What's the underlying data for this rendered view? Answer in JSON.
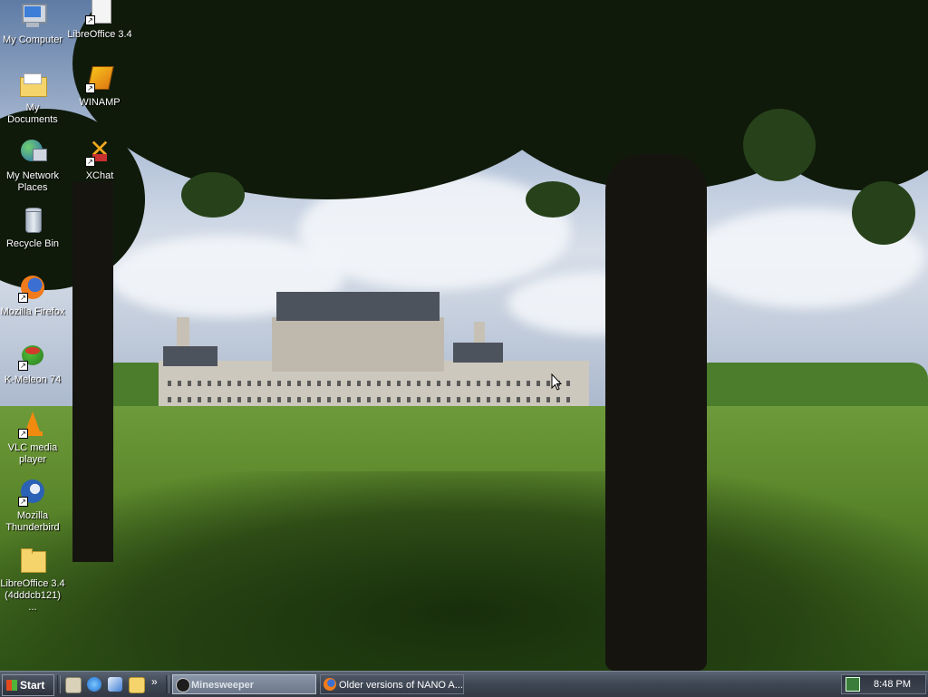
{
  "desktop": {
    "icons": [
      {
        "label": "My Computer",
        "icon": "computer-icon",
        "shortcut": false
      },
      {
        "label": "LibreOffice 3.4",
        "icon": "document-icon",
        "shortcut": true
      },
      {
        "label": "My Documents",
        "icon": "folder-icon",
        "shortcut": false
      },
      {
        "label": "WINAMP",
        "icon": "winamp-icon",
        "shortcut": true
      },
      {
        "label": "My Network Places",
        "icon": "network-icon",
        "shortcut": false
      },
      {
        "label": "XChat",
        "icon": "xchat-icon",
        "shortcut": true
      },
      {
        "label": "Recycle Bin",
        "icon": "recycle-bin-icon",
        "shortcut": false
      },
      {
        "label": "Mozilla Firefox",
        "icon": "firefox-icon",
        "shortcut": true
      },
      {
        "label": "K-Meleon 74",
        "icon": "kmeleon-icon",
        "shortcut": true
      },
      {
        "label": "VLC media player",
        "icon": "vlc-icon",
        "shortcut": true
      },
      {
        "label": "Mozilla Thunderbird",
        "icon": "thunderbird-icon",
        "shortcut": true
      },
      {
        "label": "LibreOffice 3.4 (4dddcb121) ...",
        "icon": "folder-icon",
        "shortcut": false
      }
    ]
  },
  "taskbar": {
    "start_label": "Start",
    "quick_launch": [
      "show-desktop-icon",
      "internet-explorer-icon",
      "outlook-express-icon",
      "windows-explorer-icon"
    ],
    "overflow_label": "»",
    "tasks": [
      {
        "label": "Minesweeper",
        "icon": "minesweeper-icon",
        "active": true
      },
      {
        "label": "Older versions of NANO A...",
        "icon": "firefox-icon",
        "active": false
      }
    ],
    "clock": "8:48 PM",
    "tray_icons": [
      "network-tray-icon"
    ]
  },
  "colors": {
    "taskbar": "#3e4653",
    "active_task": "#7a869a",
    "label_text": "#ffffff"
  }
}
